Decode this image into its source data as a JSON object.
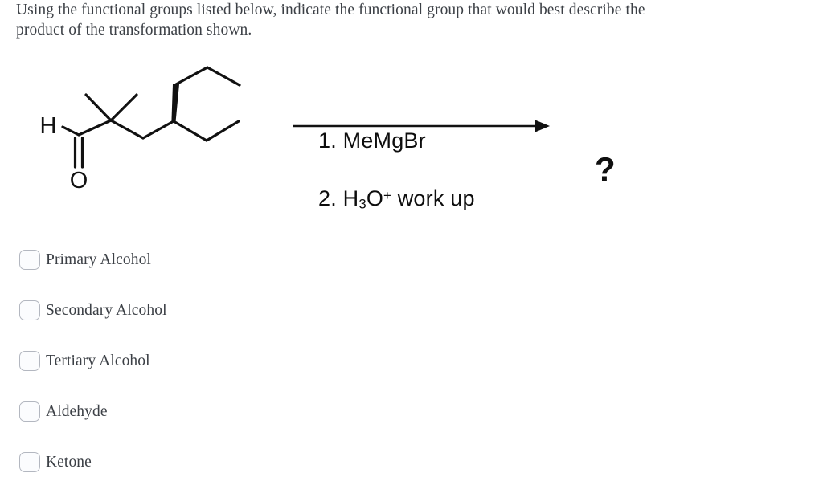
{
  "question": {
    "prompt": "Using the functional groups listed below, indicate the functional group that would best describe the product of the transformation shown."
  },
  "reaction": {
    "reactant": {
      "name": "2,2-dimethyl-4-ethylhexanal-type aldehyde skeleton",
      "atom_labels": {
        "hydrogen": "H",
        "oxygen": "O"
      }
    },
    "reagents": {
      "step1": "1. MeMgBr",
      "step2_prefix": "2. H",
      "step2_sub": "3",
      "step2_mid": "O",
      "step2_sup": "+",
      "step2_suffix": " work up"
    },
    "product_placeholder": "?",
    "arrow_color": "#111111",
    "bond_color": "#111111"
  },
  "options": [
    {
      "label": "Primary Alcohol",
      "checked": false
    },
    {
      "label": "Secondary Alcohol",
      "checked": false
    },
    {
      "label": "Tertiary Alcohol",
      "checked": false
    },
    {
      "label": "Aldehyde",
      "checked": false
    },
    {
      "label": "Ketone",
      "checked": false
    }
  ],
  "colors": {
    "background": "#ffffff",
    "text": "#3c4046",
    "checkbox_border": "#b3b7c0",
    "checkbox_fill": "#fbfcfe",
    "ink": "#111111"
  }
}
